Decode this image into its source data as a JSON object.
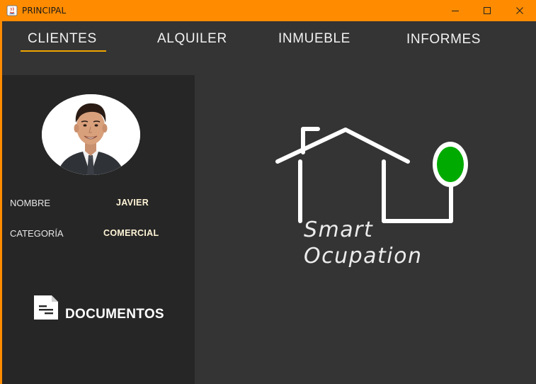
{
  "window": {
    "title": "PRINCIPAL"
  },
  "nav": {
    "tabs": [
      {
        "label": "CLIENTES",
        "active": true
      },
      {
        "label": "ALQUILER",
        "active": false
      },
      {
        "label": "INMUEBLE",
        "active": false
      },
      {
        "label": "INFORMES",
        "active": false
      }
    ]
  },
  "client": {
    "name_label": "NOMBRE",
    "name_value": "JAVIER",
    "category_label": "CATEGORÍA",
    "category_value": "COMERCIAL"
  },
  "documents": {
    "label": "DOCUMENTOS",
    "icon": "document-icon"
  },
  "logo": {
    "line1": "Smart",
    "line2": "Ocupation",
    "icon": "house-tree-icon",
    "tree_color": "#00aa00"
  },
  "colors": {
    "titlebar": "#fe8b00",
    "tab_underline": "#f0a400",
    "background": "#343434",
    "sidebar": "#262626"
  }
}
